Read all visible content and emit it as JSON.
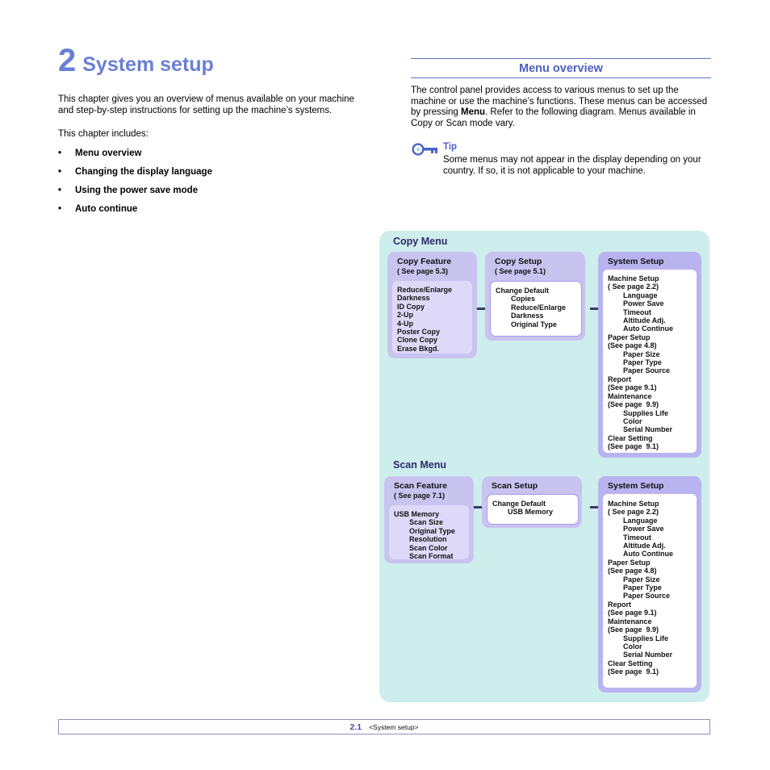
{
  "chapter": {
    "number": "2",
    "title": "System setup",
    "intro": "This chapter gives you an overview of menus available on your machine and step-by-step instructions for setting up the machine’s systems.",
    "includes_label": "This chapter includes:",
    "bullet_marker": "•",
    "bullets": [
      "Menu overview",
      "Changing the display language",
      "Using the power save mode",
      "Auto continue"
    ]
  },
  "section": {
    "title": "Menu overview",
    "body_1": "The control panel provides access to various menus to set up the machine or use the machine’s functions. These menus can be accessed by pressing ",
    "body_menu_bold": "Menu",
    "body_2": ". Refer to the following diagram. Menus available in Copy or Scan mode vary.",
    "tip_label": "Tip",
    "tip_text": "Some menus may not appear in the display depending on your country. If so, it is not applicable to your machine."
  },
  "diagram": {
    "copy_menu_heading": "Copy Menu",
    "scan_menu_heading": "Scan  Menu",
    "copy_feature": {
      "title": "Copy Feature",
      "page": "( See page 5.3)",
      "items": [
        "Reduce/Enlarge",
        "Darkness",
        "ID Copy",
        "2-Up",
        "4-Up",
        "Poster Copy",
        "Clone Copy",
        "Erase Bkgd."
      ]
    },
    "copy_setup": {
      "title": "Copy Setup",
      "page": "( See page 5.1)",
      "items": [
        {
          "text": "Change Default",
          "indent": 0
        },
        {
          "text": "Copies",
          "indent": 1
        },
        {
          "text": "Reduce/Enlarge",
          "indent": 1
        },
        {
          "text": "Darkness",
          "indent": 1
        },
        {
          "text": "Original Type",
          "indent": 1
        }
      ]
    },
    "system_setup_copy": {
      "title": "System Setup",
      "items": [
        {
          "text": "Machine Setup",
          "indent": 0,
          "bold": true
        },
        {
          "text": "( See page 2.2)",
          "indent": 0,
          "bold": false
        },
        {
          "text": "Language",
          "indent": 1,
          "bold": true
        },
        {
          "text": "Power Save",
          "indent": 1,
          "bold": true
        },
        {
          "text": "Timeout",
          "indent": 1,
          "bold": true
        },
        {
          "text": "Altitude Adj.",
          "indent": 1,
          "bold": true
        },
        {
          "text": "Auto Continue",
          "indent": 1,
          "bold": true
        },
        {
          "text": "Paper Setup",
          "indent": 0,
          "bold": true
        },
        {
          "text": "(See page 4.8)",
          "indent": 0,
          "bold": false
        },
        {
          "text": "Paper Size",
          "indent": 1,
          "bold": true
        },
        {
          "text": "Paper Type",
          "indent": 1,
          "bold": true
        },
        {
          "text": "Paper Source",
          "indent": 1,
          "bold": true
        },
        {
          "text": "Report",
          "indent": 0,
          "bold": true
        },
        {
          "text": "(See page 9.1)",
          "indent": 0,
          "bold": false
        },
        {
          "text": "Maintenance",
          "indent": 0,
          "bold": true
        },
        {
          "text": "(See page  9.9)",
          "indent": 0,
          "bold": false
        },
        {
          "text": "Supplies Life",
          "indent": 1,
          "bold": true
        },
        {
          "text": "Color",
          "indent": 1,
          "bold": true
        },
        {
          "text": "Serial Number",
          "indent": 1,
          "bold": true
        },
        {
          "text": "Clear Setting",
          "indent": 0,
          "bold": true
        },
        {
          "text": "(See page  9.1)",
          "indent": 0,
          "bold": false
        }
      ]
    },
    "scan_feature": {
      "title": "Scan Feature",
      "page": "( See page 7.1)",
      "items": [
        {
          "text": "USB Memory",
          "indent": 0
        },
        {
          "text": "Scan Size",
          "indent": 1
        },
        {
          "text": "Original Type",
          "indent": 1
        },
        {
          "text": "Resolution",
          "indent": 1
        },
        {
          "text": "Scan Color",
          "indent": 1
        },
        {
          "text": "Scan Format",
          "indent": 1
        }
      ]
    },
    "scan_setup": {
      "title": "Scan Setup",
      "items": [
        {
          "text": "Change Default",
          "indent": 0
        },
        {
          "text": "USB Memory",
          "indent": 1
        }
      ]
    },
    "system_setup_scan": {
      "title": "System Setup",
      "items": [
        {
          "text": "Machine Setup",
          "indent": 0,
          "bold": true
        },
        {
          "text": "( See page 2.2)",
          "indent": 0,
          "bold": false
        },
        {
          "text": "Language",
          "indent": 1,
          "bold": true
        },
        {
          "text": "Power Save",
          "indent": 1,
          "bold": true
        },
        {
          "text": "Timeout",
          "indent": 1,
          "bold": true
        },
        {
          "text": "Altitude Adj.",
          "indent": 1,
          "bold": true
        },
        {
          "text": "Auto Continue",
          "indent": 1,
          "bold": true
        },
        {
          "text": "Paper Setup",
          "indent": 0,
          "bold": true
        },
        {
          "text": "(See page 4.8)",
          "indent": 0,
          "bold": false
        },
        {
          "text": "Paper Size",
          "indent": 1,
          "bold": true
        },
        {
          "text": "Paper Type",
          "indent": 1,
          "bold": true
        },
        {
          "text": "Paper Source",
          "indent": 1,
          "bold": true
        },
        {
          "text": "Report",
          "indent": 0,
          "bold": true
        },
        {
          "text": "(See page 9.1)",
          "indent": 0,
          "bold": false
        },
        {
          "text": "Maintenance",
          "indent": 0,
          "bold": true
        },
        {
          "text": "(See page  9.9)",
          "indent": 0,
          "bold": false
        },
        {
          "text": "Supplies Life",
          "indent": 1,
          "bold": true
        },
        {
          "text": "Color",
          "indent": 1,
          "bold": true
        },
        {
          "text": "Serial Number",
          "indent": 1,
          "bold": true
        },
        {
          "text": "Clear Setting",
          "indent": 0,
          "bold": true
        },
        {
          "text": "(See page  9.1)",
          "indent": 0,
          "bold": false
        }
      ]
    }
  },
  "footer": {
    "page_number": "2.1",
    "label": "<System setup>"
  },
  "colors": {
    "accent": "#4c5fbf",
    "heading": "#6a7fd4",
    "diagram_bg": "#cdeeec",
    "box_lavender": "#c9c3f0",
    "box_inner": "#ded9f8",
    "box_system": "#b9b3ef"
  }
}
